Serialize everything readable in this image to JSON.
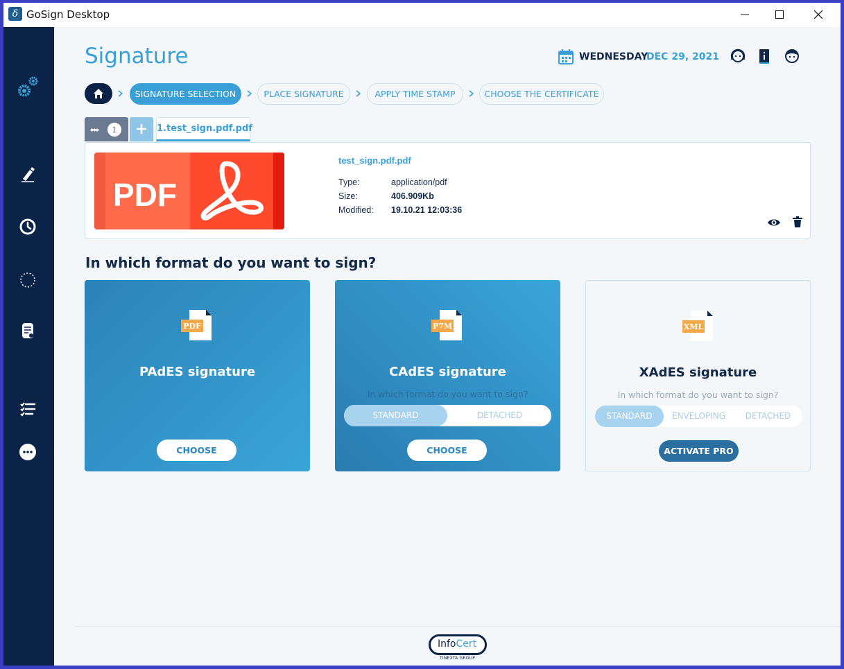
{
  "window": {
    "title": "GoSign Desktop",
    "icon_glyph": "δ"
  },
  "page": {
    "title": "Signature",
    "date_day": "WEDNESDAY",
    "date_value": "DEC 29, 2021"
  },
  "breadcrumb": {
    "steps": [
      {
        "label": "SIGNATURE SELECTION",
        "active": true
      },
      {
        "label": "PLACE SIGNATURE",
        "active": false
      },
      {
        "label": "APPLY TIME STAMP",
        "active": false
      },
      {
        "label": "CHOOSE THE CERTIFICATE",
        "active": false
      }
    ]
  },
  "tabs": {
    "more_dots": "•••",
    "count": "1",
    "file_tab": "1.test_sign.pdf.pdf"
  },
  "file": {
    "thumb_text": "PDF",
    "name": "test_sign.pdf.pdf",
    "type_label": "Type:",
    "type_value": "application/pdf",
    "size_label": "Size:",
    "size_value": "406.909Kb",
    "modified_label": "Modified:",
    "modified_value": "19.10.21 12:03:36"
  },
  "question": "In which format do you want to sign?",
  "formats": [
    {
      "badge": "PDF",
      "title": "PAdES signature",
      "button": "CHOOSE"
    },
    {
      "badge": "P7M",
      "title": "CAdES signature",
      "subtitle": "In which format do you want to sign?",
      "options": [
        "STANDARD",
        "DETACHED"
      ],
      "selected": "STANDARD",
      "button": "CHOOSE"
    },
    {
      "badge": "XML",
      "title": "XAdES signature",
      "subtitle": "In which format do you want to sign?",
      "options": [
        "STANDARD",
        "ENVELOPING",
        "DETACHED"
      ],
      "selected": "STANDARD",
      "button": "ACTIVATE PRO"
    }
  ],
  "footer": {
    "brand_info": "Info",
    "brand_cert": "Cert",
    "group": "TINEXTA GROUP"
  },
  "colors": {
    "accent": "#3a9fd6",
    "navy": "#0b2346",
    "pdf_red": "#ff4a2d",
    "badge_orange": "#f5a84a"
  },
  "icons": [
    "settings-icon",
    "sign-pen-icon",
    "clock-icon",
    "dotted-circle-icon",
    "document-icon",
    "checklist-icon",
    "more-icon",
    "calendar-icon",
    "support-icon",
    "manual-icon",
    "user-icon",
    "home-icon",
    "eye-icon",
    "trash-icon"
  ]
}
